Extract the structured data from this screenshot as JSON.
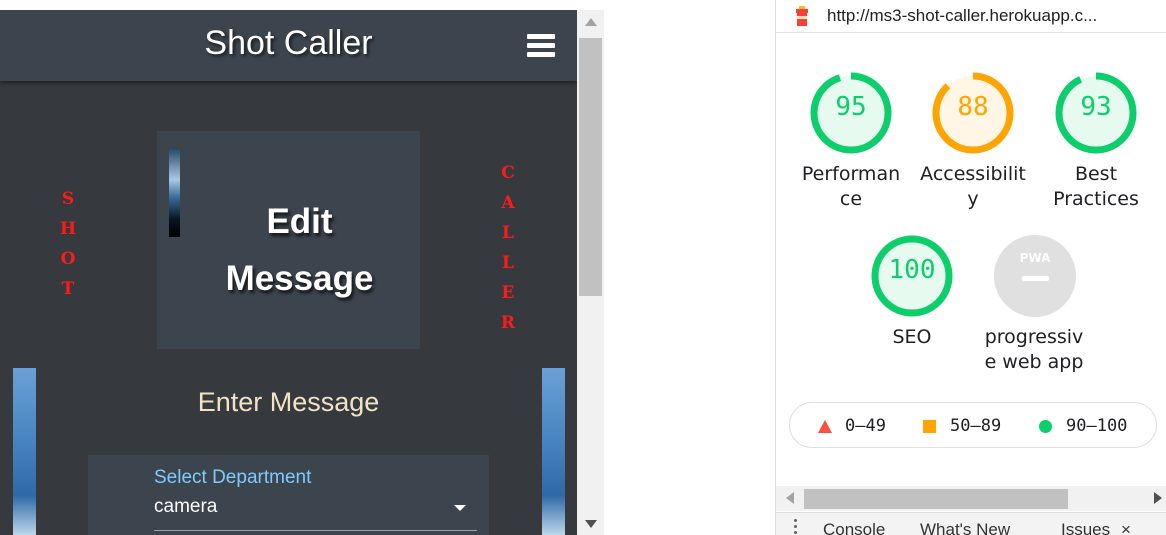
{
  "app": {
    "brand": "Shot Caller",
    "menu_icon": "hamburger-icon",
    "left_word": [
      "S",
      "H",
      "O",
      "T"
    ],
    "right_word": [
      "C",
      "A",
      "L",
      "L",
      "E",
      "R"
    ],
    "edit_title": "Edit Message",
    "enter_heading": "Enter Message",
    "department": {
      "label": "Select Department",
      "value": "camera"
    },
    "colors": {
      "background": "#363a3e",
      "navbar": "#3c444d",
      "side_word": "#ff1a1a",
      "label": "#7ecbff",
      "heading": "#f3e3c4"
    }
  },
  "lighthouse": {
    "url": "http://ms3-shot-caller.herokuapp.c...",
    "icon": "lighthouse-icon",
    "scores": {
      "performance": {
        "value": "95",
        "label_lines": [
          "Performan",
          "ce"
        ],
        "fraction": 0.95,
        "color": "#0cce6b"
      },
      "accessibility": {
        "value": "88",
        "label_lines": [
          "Accessibilit",
          "y"
        ],
        "fraction": 0.88,
        "color": "#ffa400"
      },
      "best_practices": {
        "value": "93",
        "label_lines": [
          "Best",
          "Practices"
        ],
        "fraction": 0.93,
        "color": "#0cce6b"
      },
      "seo": {
        "value": "100",
        "label_lines": [
          "SEO"
        ],
        "fraction": 1.0,
        "color": "#0cce6b"
      },
      "pwa": {
        "badge": "PWA",
        "label_lines": [
          "progressiv",
          "e web app"
        ]
      }
    },
    "legend": {
      "fail": "0–49",
      "average": "50–89",
      "pass": "90–100"
    },
    "drawer_tabs": {
      "console": "Console",
      "whats_new": "What's New",
      "issues": "Issues",
      "close_glyph": "×"
    }
  }
}
